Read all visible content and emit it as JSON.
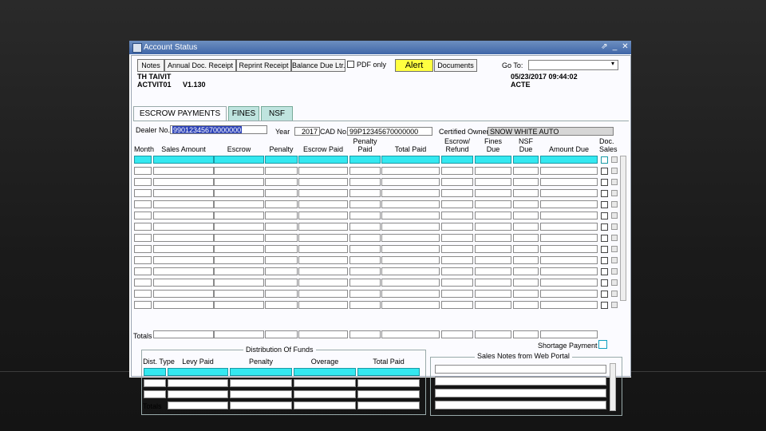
{
  "window": {
    "title": "Account Status",
    "controls": [
      "⇗",
      "_",
      "✕"
    ]
  },
  "toolbar": {
    "buttons": [
      "Notes",
      "Annual Doc. Receipt",
      "Reprint Receipt",
      "Balance Due Ltr."
    ],
    "pdf_only_label": "PDF only",
    "alert_label": "Alert",
    "documents_label": "Documents",
    "goto_label": "Go To:",
    "goto_value": ""
  },
  "header": {
    "line1_left": "TH TAIVIT",
    "line2_left": "ACTVIT01",
    "version": "V1.130",
    "datetime": "05/23/2017 09:44:02",
    "status": "ACTE"
  },
  "tabs": [
    "ESCROW PAYMENTS",
    "FINES",
    "NSF"
  ],
  "form": {
    "dealer_label": "Dealer No.",
    "dealer_value": "99012345670000000",
    "year_label": "Year",
    "year_value": "2017",
    "cad_label": "CAD No.",
    "cad_value": "99P12345670000000",
    "owner_label": "Certified Owner",
    "owner_value": "SNOW WHITE AUTO"
  },
  "columns": [
    [
      "Month"
    ],
    [
      "Sales Amount"
    ],
    [
      "Escrow"
    ],
    [
      "Penalty"
    ],
    [
      "Escrow Paid"
    ],
    [
      "Penalty",
      "Paid"
    ],
    [
      "Total Paid"
    ],
    [
      "Escrow/",
      "Refund"
    ],
    [
      "Fines",
      "Due"
    ],
    [
      "NSF",
      "Due"
    ],
    [
      "Amount Due"
    ],
    [
      "Doc.",
      "Sales"
    ]
  ],
  "totals_label": "Totals",
  "shortage_label": "Shortage Payment",
  "distribution": {
    "title": "Distribution Of Funds",
    "columns": [
      "Dist. Type",
      "Levy Paid",
      "Penalty",
      "Overage",
      "Total Paid"
    ],
    "totals_label": "Totals"
  },
  "sales_notes": {
    "title": "Sales Notes from Web Portal"
  }
}
